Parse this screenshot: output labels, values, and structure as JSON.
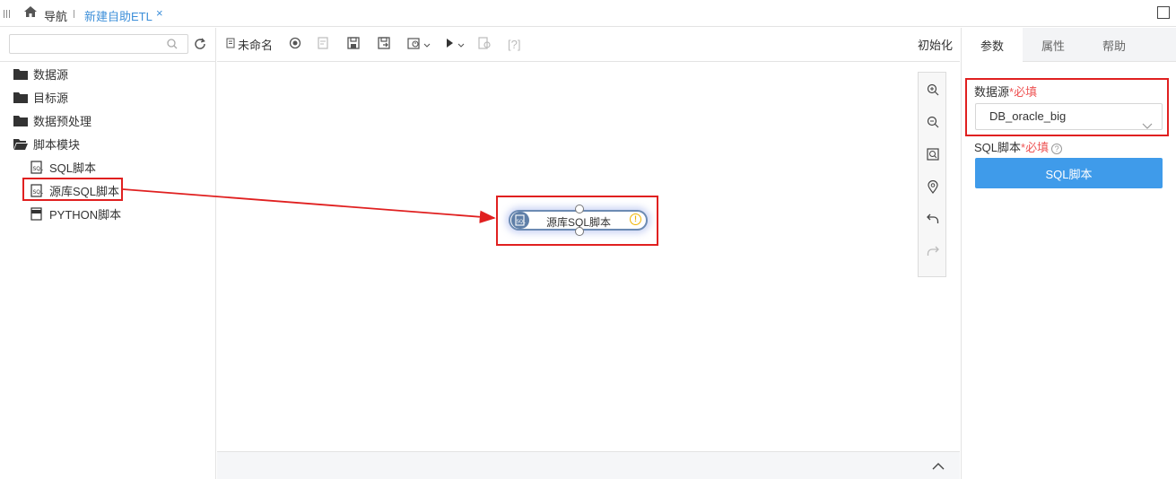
{
  "topbar": {
    "nav_label": "导航",
    "tab_label": "新建自助ETL",
    "tab_close": "×"
  },
  "left_panel": {
    "search": {
      "value": "",
      "placeholder": ""
    },
    "tree": [
      {
        "label": "数据源",
        "icon": "folder-icon"
      },
      {
        "label": "目标源",
        "icon": "folder-icon"
      },
      {
        "label": "数据预处理",
        "icon": "folder-icon"
      },
      {
        "label": "脚本模块",
        "icon": "folder-open-icon"
      },
      {
        "label": "SQL脚本",
        "icon": "sql-file-icon"
      },
      {
        "label": "源库SQL脚本",
        "icon": "sql-file-icon"
      },
      {
        "label": "PYTHON脚本",
        "icon": "python-file-icon"
      }
    ]
  },
  "toolbar": {
    "name_label": "未命名",
    "init_label": "初始化",
    "help_label": "[?]"
  },
  "canvas": {
    "node": {
      "label": "源库SQL脚本",
      "warning": "!"
    }
  },
  "right_panel": {
    "tabs": [
      "参数",
      "属性",
      "帮助"
    ],
    "active_tab": "参数",
    "datasource_label": "数据源",
    "datasource_required": "*必填",
    "datasource_value": "DB_oracle_big",
    "sql_label": "SQL脚本",
    "sql_required": "*必填",
    "sql_button": "SQL脚本"
  },
  "colors": {
    "accent": "#3f9bea",
    "tab_blue": "#3d8fd9",
    "highlight_red": "#e02020",
    "node_border": "#6c8bb3",
    "warning": "#f0b400"
  }
}
